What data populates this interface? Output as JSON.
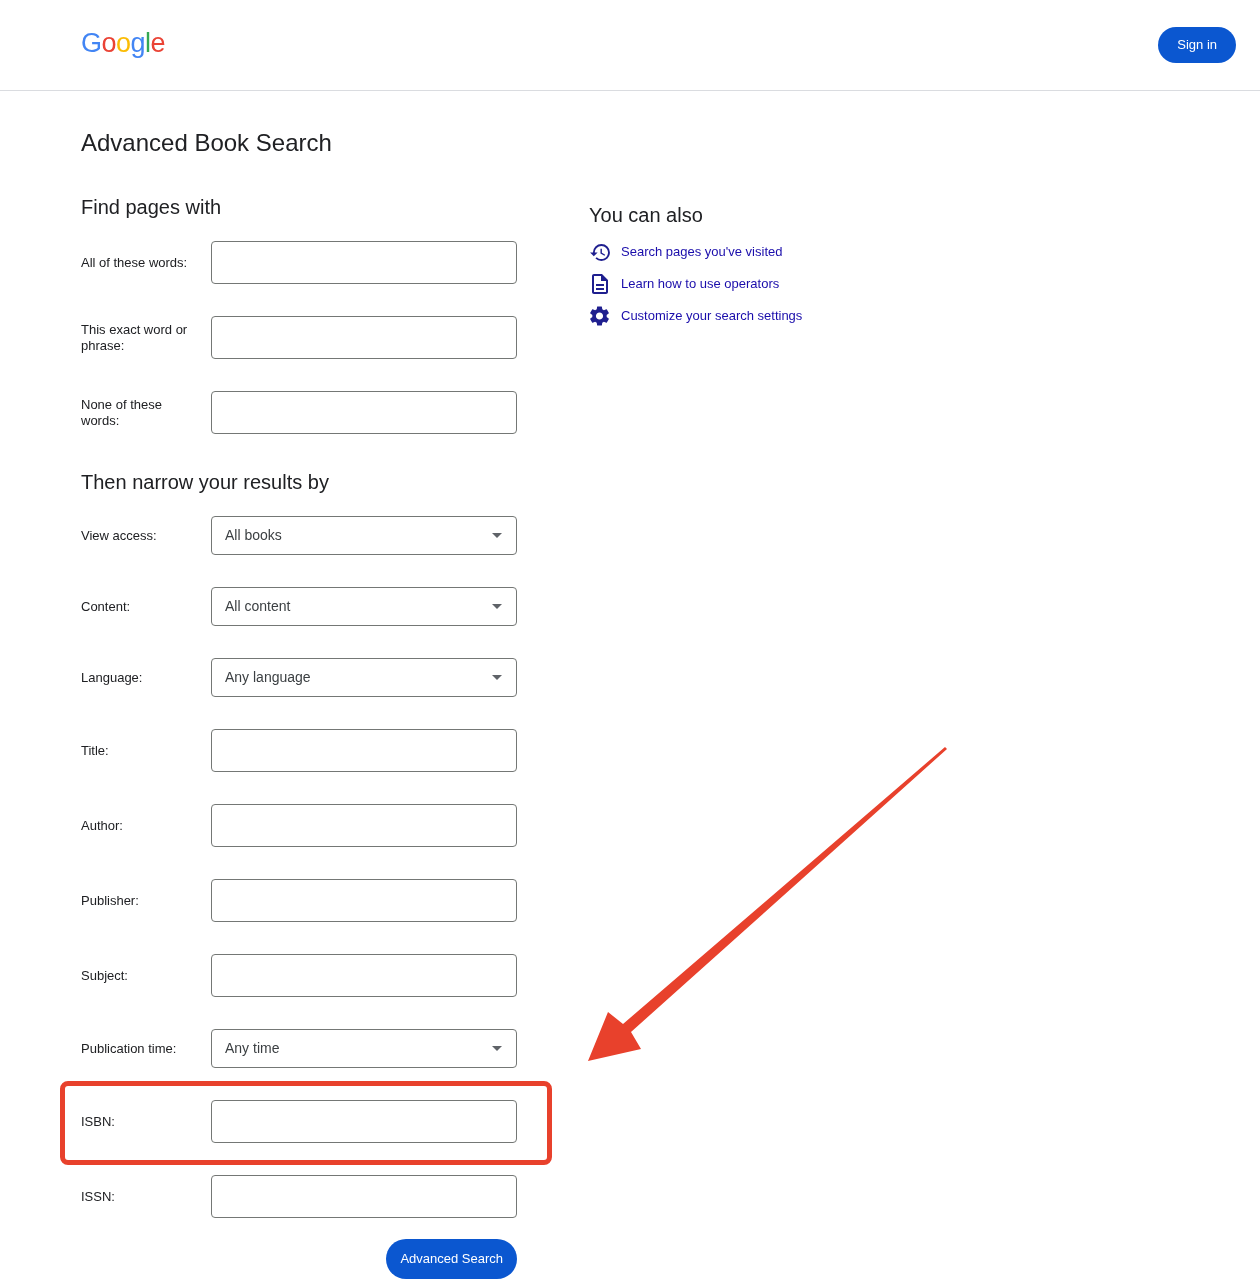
{
  "header": {
    "logo": "Google",
    "sign_in": "Sign in"
  },
  "title": "Advanced Book Search",
  "sections": [
    {
      "heading": "Find pages with",
      "fields": [
        {
          "kind": "text",
          "label": "All of these words:",
          "highlighted": false
        },
        {
          "kind": "text",
          "label": "This exact word or phrase:",
          "highlighted": false
        },
        {
          "kind": "text",
          "label": "None of these words:",
          "highlighted": false
        }
      ]
    },
    {
      "heading": "Then narrow your results by",
      "fields": [
        {
          "kind": "select",
          "label": "View access:",
          "value": "All books",
          "highlighted": false
        },
        {
          "kind": "select",
          "label": "Content:",
          "value": "All content",
          "highlighted": false
        },
        {
          "kind": "select",
          "label": "Language:",
          "value": "Any language",
          "highlighted": false
        },
        {
          "kind": "text",
          "label": "Title:",
          "highlighted": false
        },
        {
          "kind": "text",
          "label": "Author:",
          "highlighted": false
        },
        {
          "kind": "text",
          "label": "Publisher:",
          "highlighted": false
        },
        {
          "kind": "text",
          "label": "Subject:",
          "highlighted": false
        },
        {
          "kind": "select",
          "label": "Publication time:",
          "value": "Any time",
          "highlighted": false
        },
        {
          "kind": "text",
          "label": "ISBN:",
          "highlighted": true
        },
        {
          "kind": "text",
          "label": "ISSN:",
          "highlighted": false
        }
      ]
    }
  ],
  "submit": "Advanced Search",
  "side": {
    "heading": "You can also",
    "links": [
      {
        "kind": "history",
        "label": "Search pages you've visited"
      },
      {
        "kind": "document",
        "label": "Learn how to use operators"
      },
      {
        "kind": "settings",
        "label": "Customize your search settings"
      }
    ]
  }
}
